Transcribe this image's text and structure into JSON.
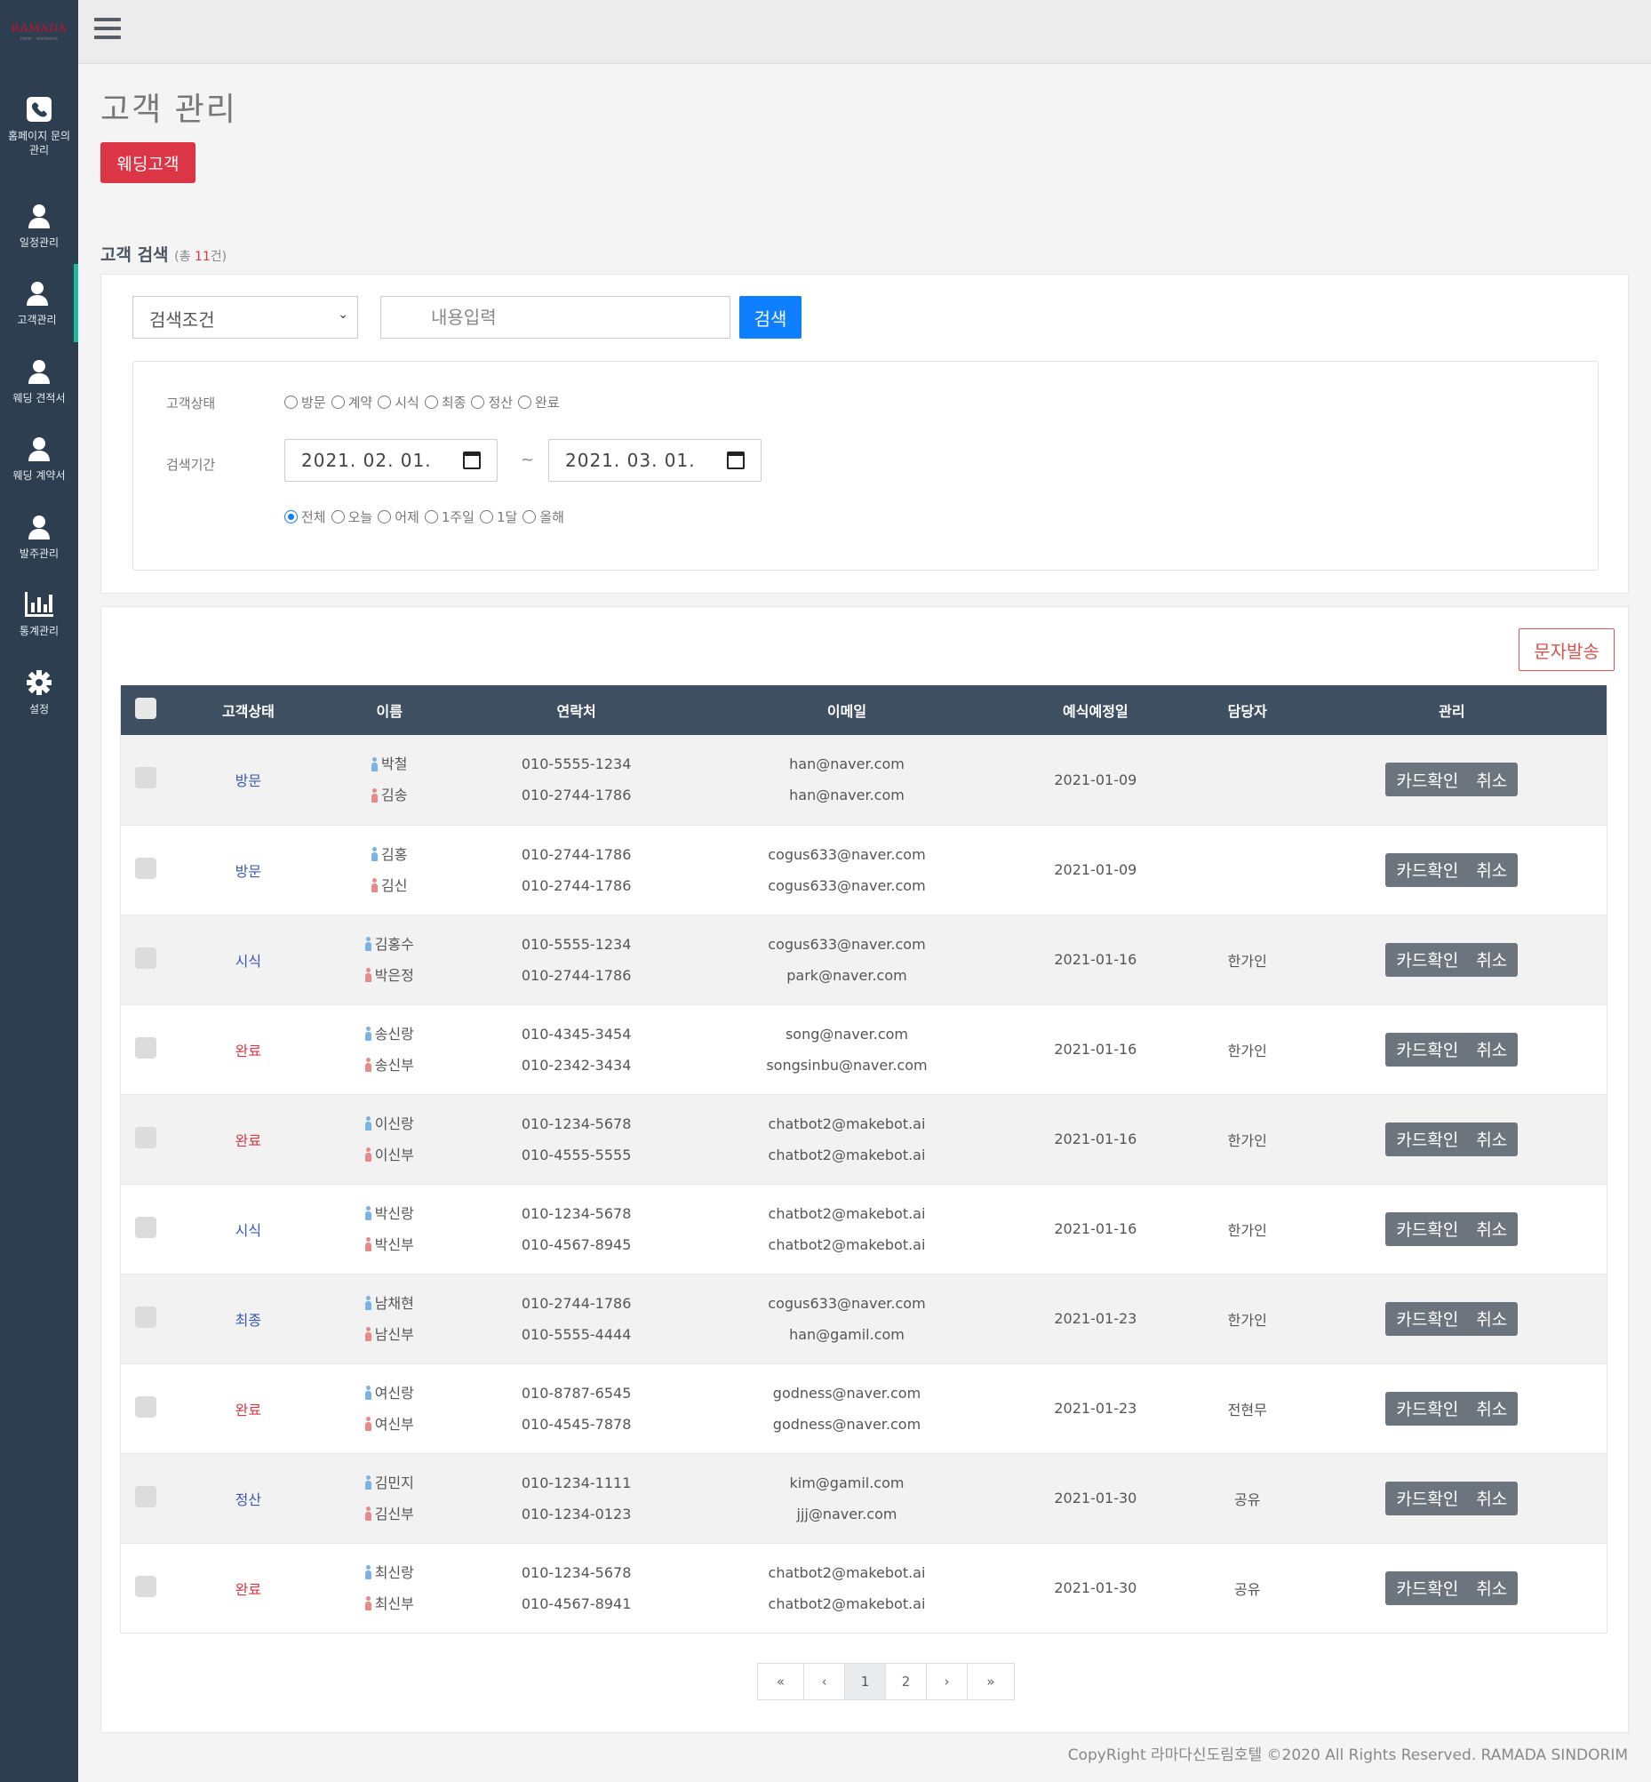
{
  "brand": {
    "logo": "RAMADA",
    "logo_sub": "hotel · residence"
  },
  "sidebar": {
    "items": [
      {
        "label": "홈페이지 문의\n관리",
        "icon": "phone-icon"
      },
      {
        "label": "일정관리",
        "icon": "user-icon"
      },
      {
        "label": "고객관리",
        "icon": "user-icon"
      },
      {
        "label": "웨딩 견적서",
        "icon": "user-icon"
      },
      {
        "label": "웨딩 계약서",
        "icon": "user-icon"
      },
      {
        "label": "발주관리",
        "icon": "user-icon"
      },
      {
        "label": "통계관리",
        "icon": "bar-chart-icon"
      },
      {
        "label": "설정",
        "icon": "gear-icon"
      }
    ]
  },
  "page": {
    "title": "고객 관리",
    "wedding_button": "웨딩고객"
  },
  "search": {
    "title": "고객 검색",
    "count_prefix": "(총 ",
    "count": "11",
    "count_suffix": "건)",
    "select_value": "검색조건",
    "input_placeholder": "내용입력",
    "button": "검색",
    "status_label": "고객상태",
    "status_options": [
      "방문",
      "계약",
      "시식",
      "최종",
      "정산",
      "완료"
    ],
    "period_label": "검색기간",
    "date_from": "2021. 02. 01.",
    "date_to": "2021. 03. 01.",
    "tilde": "~",
    "period_options": [
      "전체",
      "오늘",
      "어제",
      "1주일",
      "1달",
      "올해"
    ],
    "period_selected": "전체"
  },
  "table": {
    "sms_button": "문자발송",
    "headers": [
      "고객상태",
      "이름",
      "연락처",
      "이메일",
      "예식예정일",
      "담당자",
      "관리"
    ],
    "action_card": "카드확인",
    "action_cancel": "취소",
    "rows": [
      {
        "status": "방문",
        "status_color": "#3a58b8",
        "groom": "박철",
        "bride": "김송",
        "phone1": "010-5555-1234",
        "phone2": "010-2744-1786",
        "email1": "han@naver.com",
        "email2": "han@naver.com",
        "date": "2021-01-09",
        "manager": ""
      },
      {
        "status": "방문",
        "status_color": "#3a58b8",
        "groom": "김홍",
        "bride": "김신",
        "phone1": "010-2744-1786",
        "phone2": "010-2744-1786",
        "email1": "cogus633@naver.com",
        "email2": "cogus633@naver.com",
        "date": "2021-01-09",
        "manager": ""
      },
      {
        "status": "시식",
        "status_color": "#3a58b8",
        "groom": "김홍수",
        "bride": "박은정",
        "phone1": "010-5555-1234",
        "phone2": "010-2744-1786",
        "email1": "cogus633@naver.com",
        "email2": "park@naver.com",
        "date": "2021-01-16",
        "manager": "한가인"
      },
      {
        "status": "완료",
        "status_color": "#dc3545",
        "groom": "송신랑",
        "bride": "송신부",
        "phone1": "010-4345-3454",
        "phone2": "010-2342-3434",
        "email1": "song@naver.com",
        "email2": "songsinbu@naver.com",
        "date": "2021-01-16",
        "manager": "한가인"
      },
      {
        "status": "완료",
        "status_color": "#dc3545",
        "groom": "이신랑",
        "bride": "이신부",
        "phone1": "010-1234-5678",
        "phone2": "010-4555-5555",
        "email1": "chatbot2@makebot.ai",
        "email2": "chatbot2@makebot.ai",
        "date": "2021-01-16",
        "manager": "한가인"
      },
      {
        "status": "시식",
        "status_color": "#3a58b8",
        "groom": "박신랑",
        "bride": "박신부",
        "phone1": "010-1234-5678",
        "phone2": "010-4567-8945",
        "email1": "chatbot2@makebot.ai",
        "email2": "chatbot2@makebot.ai",
        "date": "2021-01-16",
        "manager": "한가인"
      },
      {
        "status": "최종",
        "status_color": "#3a58b8",
        "groom": "남채현",
        "bride": "남신부",
        "phone1": "010-2744-1786",
        "phone2": "010-5555-4444",
        "email1": "cogus633@naver.com",
        "email2": "han@gamil.com",
        "date": "2021-01-23",
        "manager": "한가인"
      },
      {
        "status": "완료",
        "status_color": "#dc3545",
        "groom": "여신랑",
        "bride": "여신부",
        "phone1": "010-8787-6545",
        "phone2": "010-4545-7878",
        "email1": "godness@naver.com",
        "email2": "godness@naver.com",
        "date": "2021-01-23",
        "manager": "전현무"
      },
      {
        "status": "정산",
        "status_color": "#3a58b8",
        "groom": "김민지",
        "bride": "김신부",
        "phone1": "010-1234-1111",
        "phone2": "010-1234-0123",
        "email1": "kim@gamil.com",
        "email2": "jjj@naver.com",
        "date": "2021-01-30",
        "manager": "공유"
      },
      {
        "status": "완료",
        "status_color": "#dc3545",
        "groom": "최신랑",
        "bride": "최신부",
        "phone1": "010-1234-5678",
        "phone2": "010-4567-8941",
        "email1": "chatbot2@makebot.ai",
        "email2": "chatbot2@makebot.ai",
        "date": "2021-01-30",
        "manager": "공유"
      }
    ]
  },
  "pagination": {
    "first": "«",
    "prev": "‹",
    "pages": [
      "1",
      "2"
    ],
    "current": "1",
    "next": "›",
    "last": "»"
  },
  "footer": {
    "text": "CopyRight 라마다신도림호텔 ©2020 All Rights Reserved. RAMADA SINDORIM"
  }
}
